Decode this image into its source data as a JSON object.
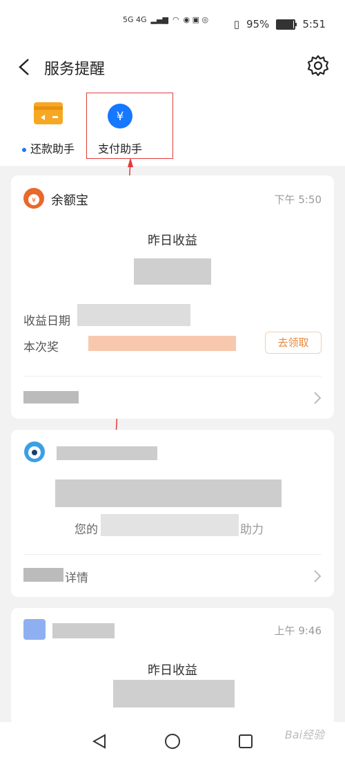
{
  "statusbar": {
    "network": "5G 4G",
    "battery": "95%",
    "battery_level": 0.95,
    "time": "5:51"
  },
  "header": {
    "title": "服务提醒"
  },
  "shortcuts": [
    {
      "label": "还款助手",
      "unread": true
    },
    {
      "label": "支付助手",
      "unread": false
    }
  ],
  "cards": [
    {
      "title": "余额宝",
      "time": "下午 5:50",
      "headline": "昨日收益",
      "row1_label": "收益日期",
      "row2_label": "本次奖",
      "action": "去领取"
    },
    {
      "subtitle_left": "您的",
      "subtitle_right": "助力",
      "footer_right": "详情"
    },
    {
      "time": "上午 9:46",
      "headline": "昨日收益"
    }
  ],
  "watermark": "Bai经验"
}
